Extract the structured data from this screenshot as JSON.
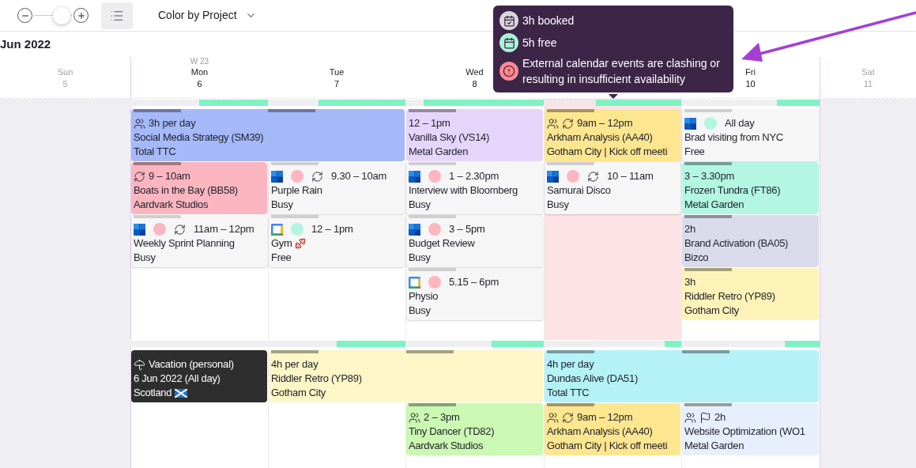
{
  "toolbar": {
    "zoom": {
      "level": 0.72
    },
    "list_view": {
      "selected": true
    },
    "color_mode": "Color by Project"
  },
  "month": "Jun 2022",
  "days": [
    {
      "kind": "day",
      "weekday": "Sun",
      "date": "5",
      "weekend": true
    },
    {
      "kind": "day",
      "weekday": "Mon",
      "date": "6",
      "week": "W 23",
      "weekend": false
    },
    {
      "kind": "day",
      "weekday": "Tue",
      "date": "7",
      "weekend": false
    },
    {
      "kind": "day",
      "weekday": "Wed",
      "date": "8",
      "weekend": false
    },
    {
      "kind": "covered"
    },
    {
      "kind": "day",
      "weekday": "Fri",
      "date": "10",
      "weekend": false
    },
    {
      "kind": "day",
      "weekday": "Sat",
      "date": "11",
      "weekend": true
    }
  ],
  "weeks": [
    {
      "days": [
        {
          "weekend": true
        },
        {
          "level": 0.5,
          "clash": false
        },
        {
          "level": 0.63,
          "clash": false
        },
        {
          "level": 0.87,
          "clash": false
        },
        {
          "level": 0.62,
          "clash": true
        },
        {
          "level": 0.31,
          "clash": false
        },
        {
          "weekend": true
        }
      ],
      "lanes": [
        [
          {
            "kind": "project",
            "color": "#a5b9f9",
            "shared": true,
            "time": "3h per day",
            "title": "Social Media Strategy (SM39)",
            "subtitle": "Total TTC"
          },
          {
            "kind": "continued"
          },
          {
            "kind": "project",
            "color": "#e6d5fb",
            "time": "12 – 1pm",
            "title": "Vanilla Sky (VS14)",
            "subtitle": "Metal Garden"
          },
          {
            "kind": "project",
            "color": "#fce690",
            "shared": true,
            "recurring": true,
            "time": "9am – 12pm",
            "title": "Arkham Analysis (AA40)",
            "subtitle": "Gotham City | Kick off meeti"
          },
          {
            "kind": "outlook_event",
            "color": "#b3f5e1",
            "time": "All day",
            "title": "Brad visiting from NYC",
            "subtitle": "Free"
          }
        ],
        [
          {
            "kind": "project",
            "color": "#fbb6c0",
            "recurring": true,
            "time": "9 – 10am",
            "title": "Boats in the Bay (BB58)",
            "subtitle": "Aardvark Studios"
          },
          {
            "kind": "outlook_event",
            "color": "#fbb6c0",
            "recurring": true,
            "time": "9.30 – 10am",
            "title": "Purple Rain",
            "subtitle": "Busy"
          },
          {
            "kind": "outlook_event",
            "color": "#fbb6c0",
            "time": "1 – 2.30pm",
            "title": "Interview with Bloomberg",
            "subtitle": "Busy"
          },
          {
            "kind": "outlook_event",
            "color": "#fbb6c0",
            "recurring": true,
            "time": "10 – 11am",
            "title": "Samurai Disco",
            "subtitle": "Busy"
          },
          {
            "kind": "project",
            "color": "#b3f6e2",
            "time": "3 – 3.30pm",
            "title": "Frozen Tundra (FT86)",
            "subtitle": "Metal Garden"
          }
        ],
        [
          {
            "kind": "outlook_event",
            "color": "#fbb6c0",
            "recurring": true,
            "time": "11am – 12pm",
            "title": "Weekly Sprint Planning",
            "subtitle": "Busy"
          },
          {
            "kind": "google_event",
            "color": "#b3f5e1",
            "time": "12 – 1pm",
            "title": "Gym",
            "title_emoji": true,
            "subtitle": "Free"
          },
          {
            "kind": "outlook_event",
            "color": "#fbb6c0",
            "time": "3 – 5pm",
            "title": "Budget Review",
            "subtitle": "Busy"
          },
          {
            "kind": "empty"
          },
          {
            "kind": "project",
            "color": "#d9dbeb",
            "time": "2h",
            "title": "Brand Activation (BA05)",
            "subtitle": "Bizco"
          }
        ],
        [
          {
            "kind": "empty"
          },
          {
            "kind": "empty"
          },
          {
            "kind": "google_event",
            "color": "#fbb6c0",
            "time": "5.15 – 6pm",
            "title": "Physio",
            "subtitle": "Busy"
          },
          {
            "kind": "empty"
          },
          {
            "kind": "project",
            "color": "#fdf3b8",
            "time": "3h",
            "title": "Riddler Retro (YP89)",
            "subtitle": "Gotham City"
          }
        ]
      ]
    },
    {
      "days": [
        {
          "weekend": true
        },
        {
          "level": 0,
          "clash": false
        },
        {
          "level": 0.5,
          "clash": false
        },
        {
          "level": 0.38,
          "clash": false
        },
        {
          "level": 0.12,
          "clash": false
        },
        {
          "level": 0.25,
          "clash": false
        },
        {
          "weekend": true
        }
      ],
      "lanes": [
        [
          {
            "kind": "vacation",
            "color": "#2e2e2e",
            "time": "Vacation (personal)",
            "title": "6 Jun 2022 (All day)",
            "subtitle": "Scotland",
            "subtitle_flag": true
          },
          {
            "kind": "project",
            "color": "#fdf6c6",
            "time": "4h per day",
            "title": "Riddler Retro (YP89)",
            "subtitle": "Gotham City"
          },
          {
            "kind": "continued"
          },
          {
            "kind": "project",
            "color": "#b4f2f8",
            "time": "4h per day",
            "title": "Dundas Alive (DA51)",
            "subtitle": "Total TTC"
          },
          {
            "kind": "continued"
          }
        ],
        [
          {
            "kind": "empty"
          },
          {
            "kind": "empty"
          },
          {
            "kind": "project",
            "color": "#cbf8b3",
            "shared": true,
            "time": "2 – 3pm",
            "title": "Tiny Dancer (TD82)",
            "subtitle": "Aardvark Studios"
          },
          {
            "kind": "project",
            "color": "#fce690",
            "shared": true,
            "recurring": true,
            "time": "9am – 12pm",
            "title": "Arkham Analysis (AA40)",
            "subtitle": "Gotham City | Kick off meeti"
          },
          {
            "kind": "project",
            "color": "#e7effc",
            "shared": true,
            "flagged": true,
            "time": "2h",
            "title": "Website Optimization (WO1",
            "subtitle": "Metal Garden"
          }
        ]
      ]
    }
  ],
  "tooltip": {
    "items": [
      {
        "kind": "booked",
        "text": "3h booked"
      },
      {
        "kind": "free",
        "text": "5h free"
      },
      {
        "kind": "warning",
        "text": "External calendar events are clashing or resulting in insufficient availability"
      }
    ]
  }
}
